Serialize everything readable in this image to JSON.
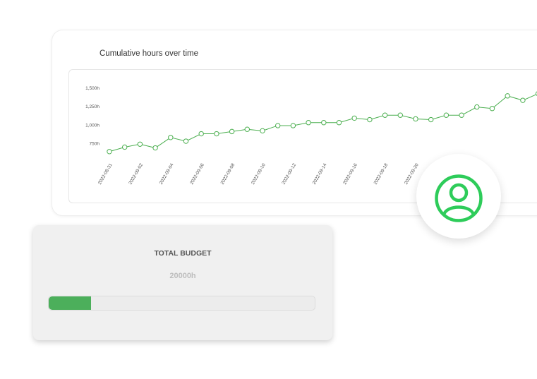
{
  "chart_card": {
    "title": "Cumulative hours over time"
  },
  "chart_data": {
    "type": "line",
    "title": "Cumulative hours over time",
    "xlabel": "",
    "ylabel": "",
    "y_ticks": [
      "750h",
      "1,000h",
      "1,250h",
      "1,500h"
    ],
    "y_tick_values": [
      750,
      1000,
      1250,
      1500
    ],
    "x_tick_labels": [
      "2022-08-31",
      "2022-09-02",
      "2022-09-04",
      "2022-09-06",
      "2022-09-08",
      "2022-09-10",
      "2022-09-12",
      "2022-09-14",
      "2022-09-16",
      "2022-09-18",
      "2022-09-20"
    ],
    "x": [
      "2022-08-31",
      "2022-09-01",
      "2022-09-02",
      "2022-09-03",
      "2022-09-04",
      "2022-09-05",
      "2022-09-06",
      "2022-09-07",
      "2022-09-08",
      "2022-09-09",
      "2022-09-10",
      "2022-09-11",
      "2022-09-12",
      "2022-09-13",
      "2022-09-14",
      "2022-09-15",
      "2022-09-16",
      "2022-09-17",
      "2022-09-18",
      "2022-09-19",
      "2022-09-20",
      "2022-09-21",
      "2022-09-22",
      "2022-09-23",
      "2022-09-24",
      "2022-09-25",
      "2022-09-26",
      "2022-09-27",
      "2022-09-28"
    ],
    "series": [
      {
        "values": [
          640,
          700,
          740,
          690,
          830,
          780,
          880,
          880,
          910,
          940,
          920,
          990,
          990,
          1030,
          1030,
          1030,
          1090,
          1070,
          1130,
          1130,
          1080,
          1070,
          1130,
          1130,
          1240,
          1220,
          1390,
          1330,
          1420
        ]
      }
    ],
    "ylim": [
      600,
      1550
    ],
    "grid": false,
    "legend": "none",
    "colors": {
      "line": "#4caf50",
      "marker_fill": "#ffffff",
      "tick_text": "#555555"
    }
  },
  "budget": {
    "title": "TOTAL BUDGET",
    "value": "20000h",
    "progress_fraction": 0.16,
    "fill_color": "#4caf5b"
  },
  "avatar": {
    "icon": "user-circle-icon",
    "color": "#2ecc5a"
  }
}
